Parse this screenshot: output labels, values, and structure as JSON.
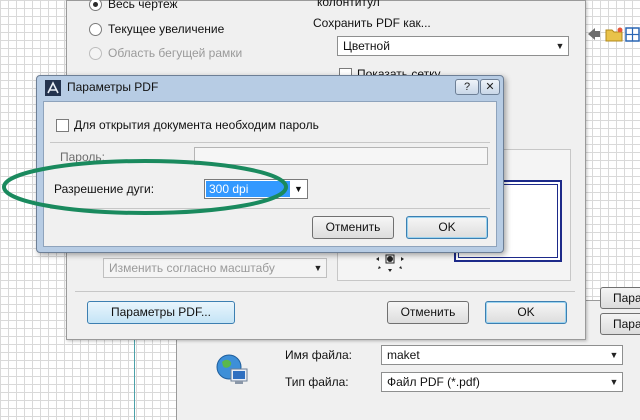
{
  "settings_dialog": {
    "radio_whole_drawing": "Весь чертеж",
    "radio_current_zoom": "Текущее увеличение",
    "radio_marquee_area": "Область бегущей рамки",
    "header_footer_label": "колонтитул",
    "save_pdf_as_label": "Сохранить PDF как...",
    "color_mode_value": "Цветной",
    "show_grid_label": "Показать сетку",
    "scale_mode_value": "Изменить согласно масштабу",
    "pdf_params_button": "Параметры PDF...",
    "cancel_button": "Отменить",
    "ok_button": "OK"
  },
  "pdf_modal": {
    "title": "Параметры PDF",
    "help_glyph": "?",
    "close_glyph": "✕",
    "password_required_label": "Для открытия документа необходим пароль",
    "password_label": "Пароль:",
    "arc_resolution_label": "Разрешение дуги:",
    "arc_resolution_value": "300 dpi",
    "cancel_button": "Отменить",
    "ok_button": "OK"
  },
  "save_dialog": {
    "file_name_label": "Имя файла:",
    "file_name_value": "maket",
    "file_type_label": "Тип файла:",
    "file_type_value": "Файл PDF (*.pdf)",
    "side_button_1": "Пара",
    "side_button_2": "Пара"
  },
  "colors": {
    "highlight": "#1a8a5e",
    "selection": "#3399ff",
    "modal_frame": "#b7cce4"
  },
  "icons": {
    "modal_app": "archicad-logo-icon",
    "file_type": "globe-monitor-icon",
    "toolbar": [
      "back-arrow-icon",
      "folder-icon",
      "grid-view-icon"
    ]
  }
}
